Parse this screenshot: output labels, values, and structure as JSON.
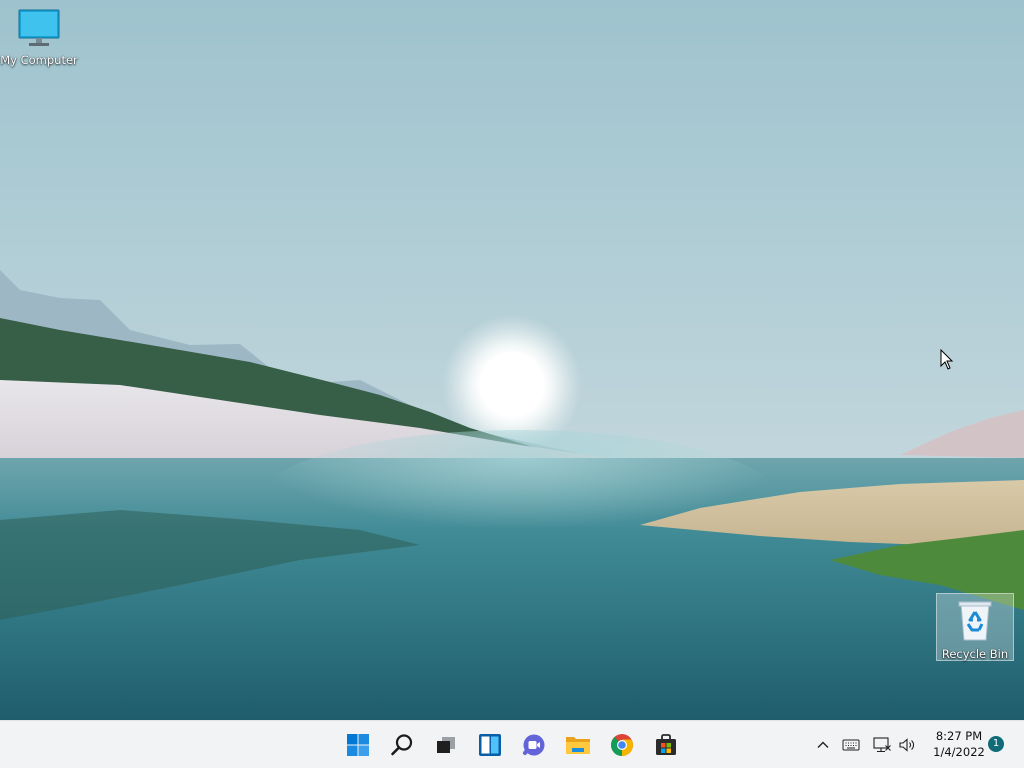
{
  "desktop": {
    "icons": [
      {
        "label": "My Computer",
        "icon": "monitor-icon"
      },
      {
        "label": "Recycle Bin",
        "icon": "recycle-bin-icon"
      }
    ]
  },
  "taskbar": {
    "apps": [
      {
        "name": "Start",
        "icon": "windows-logo-icon"
      },
      {
        "name": "Search",
        "icon": "search-icon"
      },
      {
        "name": "Task View",
        "icon": "task-view-icon"
      },
      {
        "name": "Widgets",
        "icon": "widgets-icon"
      },
      {
        "name": "Chat",
        "icon": "teams-chat-icon"
      },
      {
        "name": "File Explorer",
        "icon": "folder-icon"
      },
      {
        "name": "Google Chrome",
        "icon": "chrome-icon"
      },
      {
        "name": "Microsoft Store",
        "icon": "store-icon"
      }
    ],
    "tray": {
      "icons": [
        "chevron-up-icon",
        "keyboard-icon",
        "network-icon",
        "speaker-icon"
      ],
      "time": "8:27 PM",
      "date": "1/4/2022",
      "notification_count": "1"
    }
  },
  "colors": {
    "taskbar_bg": "#f1f3f5",
    "windows_blue": "#0078d4",
    "accent_teal": "#0f6b78"
  }
}
